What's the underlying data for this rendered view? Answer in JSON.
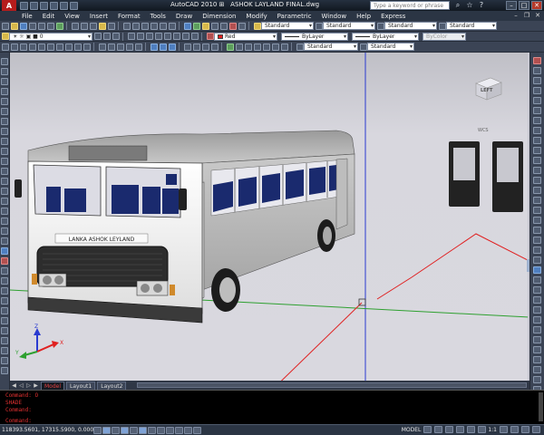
{
  "titlebar": {
    "logo": "A",
    "title": "AutoCAD 2010",
    "separator": "⊞",
    "filename": "ASHOK LAYLAND FINAL.dwg",
    "search_placeholder": "Type a keyword or phrase",
    "icons": [
      "binoculars-icon",
      "star-icon",
      "help-icon"
    ]
  },
  "menubar": {
    "items": [
      "File",
      "Edit",
      "View",
      "Insert",
      "Format",
      "Tools",
      "Draw",
      "Dimension",
      "Modify",
      "Parametric",
      "Window",
      "Help",
      "Express"
    ]
  },
  "toolbar_styles": {
    "text_style": "Standard",
    "dim_style": "Standard",
    "table_style": "Standard",
    "mleader_style": "Standard"
  },
  "layers": {
    "current_layer": "0",
    "color": "Red",
    "color_hex": "#e02020",
    "linetype": "ByLayer",
    "lineweight": "ByLayer",
    "plotstyle": "ByColor"
  },
  "toolbar3": {
    "style_combo": "Standard",
    "combo2": "Standard"
  },
  "viewcube": {
    "face": "LEFT",
    "wcs": "WCS"
  },
  "bus": {
    "destination_text": "LANKA ASHOK LEYLAND"
  },
  "layout_tabs": [
    "Model",
    "Layout1",
    "Layout2"
  ],
  "command_line": {
    "history": [
      "Command: O",
      "SHADE",
      "Command:"
    ],
    "prompt": "Command:"
  },
  "statusbar": {
    "coordinates": "118393.5601, 17315.5900, 0.0000",
    "model_label": "MODEL",
    "scale": "1:1"
  },
  "colors": {
    "viewport_bg": "#d7d6dd",
    "ucs_red": "#e02020",
    "ucs_green": "#2ea030",
    "ucs_blue": "#2a3ad0",
    "bus_body": "#f4f4f4",
    "bus_seat": "#1a2a6e"
  }
}
